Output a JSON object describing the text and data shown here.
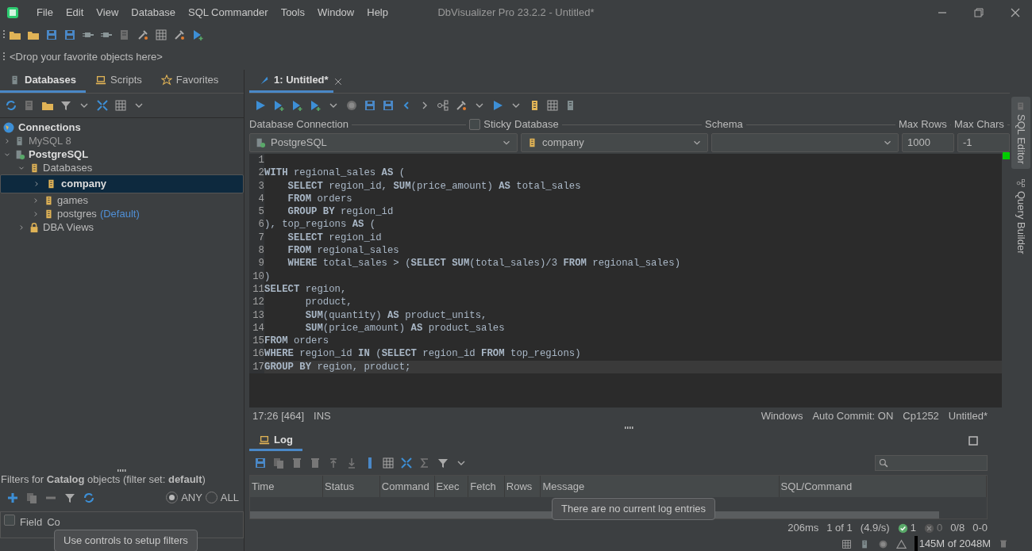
{
  "window": {
    "title": "DbVisualizer Pro 23.2.2 - Untitled*"
  },
  "menu": [
    "File",
    "Edit",
    "View",
    "Database",
    "SQL Commander",
    "Tools",
    "Window",
    "Help"
  ],
  "favorites_bar": {
    "hint": "<Drop your favorite objects here>"
  },
  "left_tabs": [
    {
      "label": "Databases",
      "selected": true
    },
    {
      "label": "Scripts",
      "selected": false
    },
    {
      "label": "Favorites",
      "selected": false
    }
  ],
  "tree": {
    "label": "Connections",
    "children": [
      {
        "label": "MySQL 8",
        "kind": "connection",
        "connected": false,
        "expanded": false,
        "selected": false
      },
      {
        "label": "PostgreSQL",
        "kind": "connection",
        "connected": true,
        "expanded": true,
        "selected": false,
        "children": [
          {
            "label": "Databases",
            "kind": "folder",
            "expanded": true,
            "selected": false,
            "children": [
              {
                "label": "company",
                "kind": "database",
                "expanded": false,
                "selected": true
              },
              {
                "label": "games",
                "kind": "database",
                "expanded": false,
                "selected": false
              },
              {
                "label": "postgres",
                "kind": "database",
                "expanded": false,
                "selected": false,
                "note": "(Default)"
              }
            ]
          },
          {
            "label": "DBA Views",
            "kind": "lock",
            "expanded": false,
            "selected": false
          }
        ]
      }
    ]
  },
  "filters": {
    "title": "Filters for **Catalog** objects (filter set: **default**)",
    "match": [
      {
        "label": "ANY",
        "selected": true
      },
      {
        "label": "ALL",
        "selected": false
      }
    ],
    "select_all": {
      "checked": false
    },
    "columns": [
      "Field",
      "Co"
    ],
    "tooltip": "Use controls to setup filters"
  },
  "editor": {
    "tab": {
      "label": "1: Untitled*",
      "selected": true
    },
    "connection_label": "Database Connection",
    "sticky": {
      "label": "Sticky",
      "checked": false
    },
    "database_label": "Database",
    "schema_label": "Schema",
    "max_rows_label": "Max Rows",
    "max_chars_label": "Max Chars",
    "connection": "PostgreSQL",
    "database": "company",
    "max_rows": "1000",
    "max_chars": "-1",
    "lines": [
      {
        "number": "1",
        "current": false
      },
      {
        "number": "2",
        "code": "**WITH** regional_sales **AS** (",
        "current": false
      },
      {
        "number": "3",
        "code": "    **SELECT** region_id, **SUM**(price_amount) **AS** total_sales",
        "current": false
      },
      {
        "number": "4",
        "code": "    **FROM** orders",
        "current": false
      },
      {
        "number": "5",
        "code": "    **GROUP BY** region_id",
        "current": false
      },
      {
        "number": "6",
        "code": "), top_regions **AS** (",
        "current": false
      },
      {
        "number": "7",
        "code": "    **SELECT** region_id",
        "current": false
      },
      {
        "number": "8",
        "code": "    **FROM** regional_sales",
        "current": false
      },
      {
        "number": "9",
        "code": "    **WHERE** total_sales > (**SELECT** **SUM**(total_sales)/3 **FROM** regional_sales)",
        "current": false
      },
      {
        "number": "10",
        "code": ")",
        "current": false
      },
      {
        "number": "11",
        "code": "**SELECT** region,",
        "current": false
      },
      {
        "number": "12",
        "code": "       product,",
        "current": false
      },
      {
        "number": "13",
        "code": "       **SUM**(quantity) **AS** product_units,",
        "current": false
      },
      {
        "number": "14",
        "code": "       **SUM**(price_amount) **AS** product_sales",
        "current": false
      },
      {
        "number": "15",
        "code": "**FROM** orders",
        "current": false
      },
      {
        "number": "16",
        "code": "**WHERE** region_id **IN** (**SELECT** region_id **FROM** top_regions)",
        "current": false
      },
      {
        "number": "17",
        "code": "**GROUP BY** region, product;",
        "current": true
      }
    ]
  },
  "editor_status": {
    "position": "17:26 [464]",
    "mode": "INS",
    "items": [
      "Windows",
      "Auto Commit: ON",
      "Cp1252",
      "Untitled*"
    ]
  },
  "side_tabs": [
    {
      "label": "SQL Editor",
      "selected": true
    },
    {
      "label": "Query Builder",
      "selected": false
    }
  ],
  "log": {
    "tab": {
      "label": "Log",
      "selected": true
    },
    "columns": [
      "Time",
      "Status",
      "Command",
      "Exec",
      "Fetch",
      "Rows",
      "Message",
      "SQL/Command"
    ],
    "tooltip": "There are no current log entries",
    "stats": [
      "206ms",
      "1 of 1",
      "(4.9/s)"
    ],
    "ok_count": "1",
    "error_count": "0",
    "ranges": [
      "0/8",
      "0-0"
    ]
  },
  "memory": "145M of 2048M"
}
